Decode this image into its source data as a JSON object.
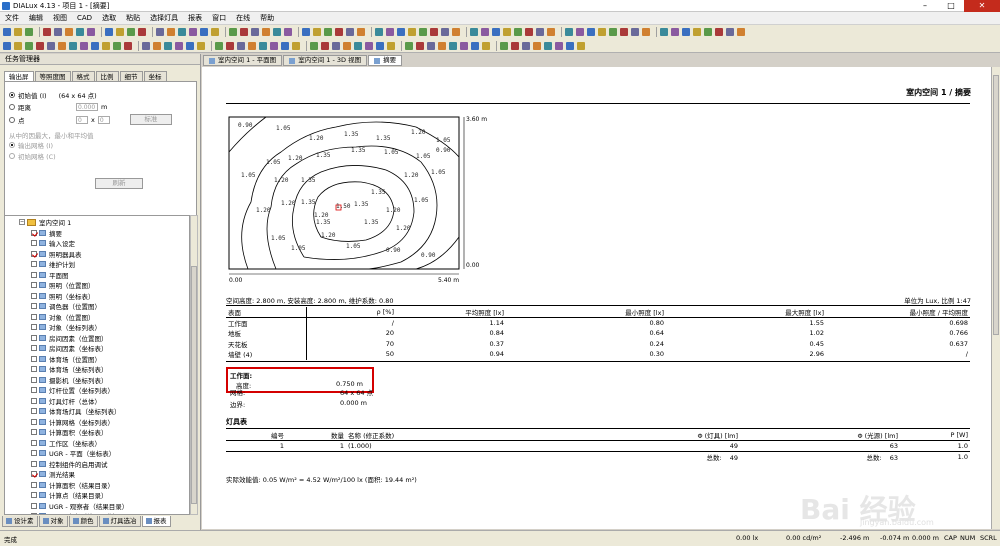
{
  "window": {
    "title": "DIALux 4.13 - 项目 1 - [摘要]"
  },
  "menu": [
    "文件",
    "编辑",
    "视图",
    "CAD",
    "选取",
    "粘贴",
    "选择灯具",
    "报表",
    "窗口",
    "在线",
    "帮助"
  ],
  "task_manager": {
    "title": "任务管理器",
    "tabs": [
      "输出屏",
      "等照度图",
      "格式",
      "比例",
      "细节",
      "坐标"
    ],
    "options": {
      "initial_value_label": "初始值 (I)",
      "initial_value_points": "(64 x 64 点)",
      "distance_label": "距离",
      "distance_value": "0.000",
      "distance_unit": "m",
      "point_label": "点",
      "point_x": "0",
      "point_y": "0",
      "point_button": "标准",
      "section_label": "从中的因最大，最小和平均值",
      "output_grid": "输出网格 (I)",
      "initial_grid": "初始网格 (C)",
      "refresh_button": "刷新"
    },
    "tree": [
      {
        "label": "室内空间 1",
        "type": "folder",
        "level": 0,
        "checked": false
      },
      {
        "label": "摘要",
        "level": 1,
        "checked": true
      },
      {
        "label": "输入设定",
        "level": 1,
        "checked": false
      },
      {
        "label": "照明器具表",
        "level": 1,
        "checked": true
      },
      {
        "label": "维护计划",
        "level": 1,
        "checked": false
      },
      {
        "label": "平面图",
        "level": 1,
        "checked": false
      },
      {
        "label": "照明（位置图）",
        "level": 1,
        "checked": false
      },
      {
        "label": "照明（坐标表）",
        "level": 1,
        "checked": false
      },
      {
        "label": "调色器（位置图）",
        "level": 1,
        "checked": false
      },
      {
        "label": "对象（位置图）",
        "level": 1,
        "checked": false
      },
      {
        "label": "对象（坐标列表）",
        "level": 1,
        "checked": false
      },
      {
        "label": "房间因素（位置图）",
        "level": 1,
        "checked": false
      },
      {
        "label": "房间因素（坐标表）",
        "level": 1,
        "checked": false
      },
      {
        "label": "体育场（位置图）",
        "level": 1,
        "checked": false
      },
      {
        "label": "体育场（坐标列表）",
        "level": 1,
        "checked": false
      },
      {
        "label": "摄影机（坐标列表）",
        "level": 1,
        "checked": false
      },
      {
        "label": "灯杆位置（坐标列表）",
        "level": 1,
        "checked": false
      },
      {
        "label": "灯具灯杆（总体）",
        "level": 1,
        "checked": false
      },
      {
        "label": "体育场灯具（坐标列表）",
        "level": 1,
        "checked": false
      },
      {
        "label": "计算网格（坐标列表）",
        "level": 1,
        "checked": false
      },
      {
        "label": "计算面积（坐标表）",
        "level": 1,
        "checked": false
      },
      {
        "label": "工作区（坐标表）",
        "level": 1,
        "checked": false
      },
      {
        "label": "UGR - 平面（坐标表）",
        "level": 1,
        "checked": false
      },
      {
        "label": "控制组件的启用调试",
        "level": 1,
        "checked": false
      },
      {
        "label": "测光结果",
        "level": 1,
        "checked": true
      },
      {
        "label": "计算面积（结果目录）",
        "level": 1,
        "checked": false
      },
      {
        "label": "计算点（结果目录）",
        "level": 1,
        "checked": false
      },
      {
        "label": "UGR - 观察者（结果目录）",
        "level": 1,
        "checked": false
      },
      {
        "label": "GR 观察者（结果一览）",
        "level": 1,
        "checked": false
      }
    ],
    "bottom_tabs": [
      "设计素",
      "对象",
      "颜色",
      "灯具选冶",
      "报表"
    ]
  },
  "doc_tabs": [
    "室内空间 1 - 平面图",
    "室内空间 1 - 3D 视图",
    "摘要"
  ],
  "report": {
    "title": "室内空间 1 / 摘要",
    "isoline": {
      "width_label": "5.40 m",
      "height_label": "3.60 m",
      "origin_x": "0.00",
      "origin_y": "0.00",
      "labels": [
        "0.90",
        "1.05",
        "1.20",
        "1.35",
        "1.35",
        "1.20",
        "1.05",
        "0.90",
        "1.05",
        "1.20",
        "1.35",
        "1.35",
        "1.05",
        "1.05",
        "1.05",
        "1.20",
        "1.35",
        "1.50",
        "1.35",
        "1.20",
        "1.05",
        "1.20",
        "1.35",
        "1.35",
        "1.20",
        "1.05",
        "1.20",
        "1.20",
        "1.35",
        "1.35",
        "1.20",
        "1.05",
        "1.05",
        "1.20",
        "1.05",
        "0.90",
        "0.90"
      ]
    },
    "room_line": "空间高度: 2.800 m, 安装高度: 2.800 m, 维护系数: 0.80",
    "unit_line": "单位为 Lux, 比例 1:47",
    "surface_table": {
      "headers": [
        "表面",
        "ρ [%]",
        "平均照度 [lx]",
        "最小照度 [lx]",
        "最大照度 [lx]",
        "最小照度 / 平均照度"
      ],
      "rows": [
        [
          "工作面",
          "/",
          "1.14",
          "0.80",
          "1.55",
          "0.698"
        ],
        [
          "地板",
          "20",
          "0.84",
          "0.64",
          "1.02",
          "0.766"
        ],
        [
          "天花板",
          "70",
          "0.37",
          "0.24",
          "0.45",
          "0.637"
        ],
        [
          "墙壁 (4)",
          "50",
          "0.94",
          "0.30",
          "2.96",
          "/"
        ]
      ]
    },
    "workplane": {
      "title": "工作面:",
      "height_label": "高度:",
      "height_value": "0.750 m",
      "grid_label": "网格:",
      "grid_value": "64 x 64 点",
      "border_label": "边界:",
      "border_value": "0.000 m"
    },
    "luminaire_title": "灯具表",
    "luminaire_table": {
      "headers": [
        "编号",
        "数量",
        "名称 (修正系数)",
        "Φ (灯具) [lm]",
        "Φ (光源) [lm]",
        "P [W]"
      ],
      "rows": [
        [
          "1",
          "1",
          "(1.000)",
          "49",
          "63",
          "1.0"
        ]
      ],
      "total_label": "总数:",
      "total_lum": "49",
      "total_lamp_label": "总数:",
      "total_lamp": "63",
      "total_power": "1.0"
    },
    "efficiency": "实际效能值: 0.05 W/m² = 4.52 W/m²/100 lx (面积: 19.44 m²)"
  },
  "status": {
    "left": "完成",
    "v1": "0.00 lx",
    "v2": "0.00 cd/m²",
    "v3": "-2.496 m",
    "v4": "-0.074 m",
    "v5": "0.000 m",
    "caps": "CAP",
    "num": "NUM",
    "scrl": "SCRL"
  },
  "watermark": {
    "main": "Bai 经验",
    "sub": "jingyan.baidu.com"
  }
}
